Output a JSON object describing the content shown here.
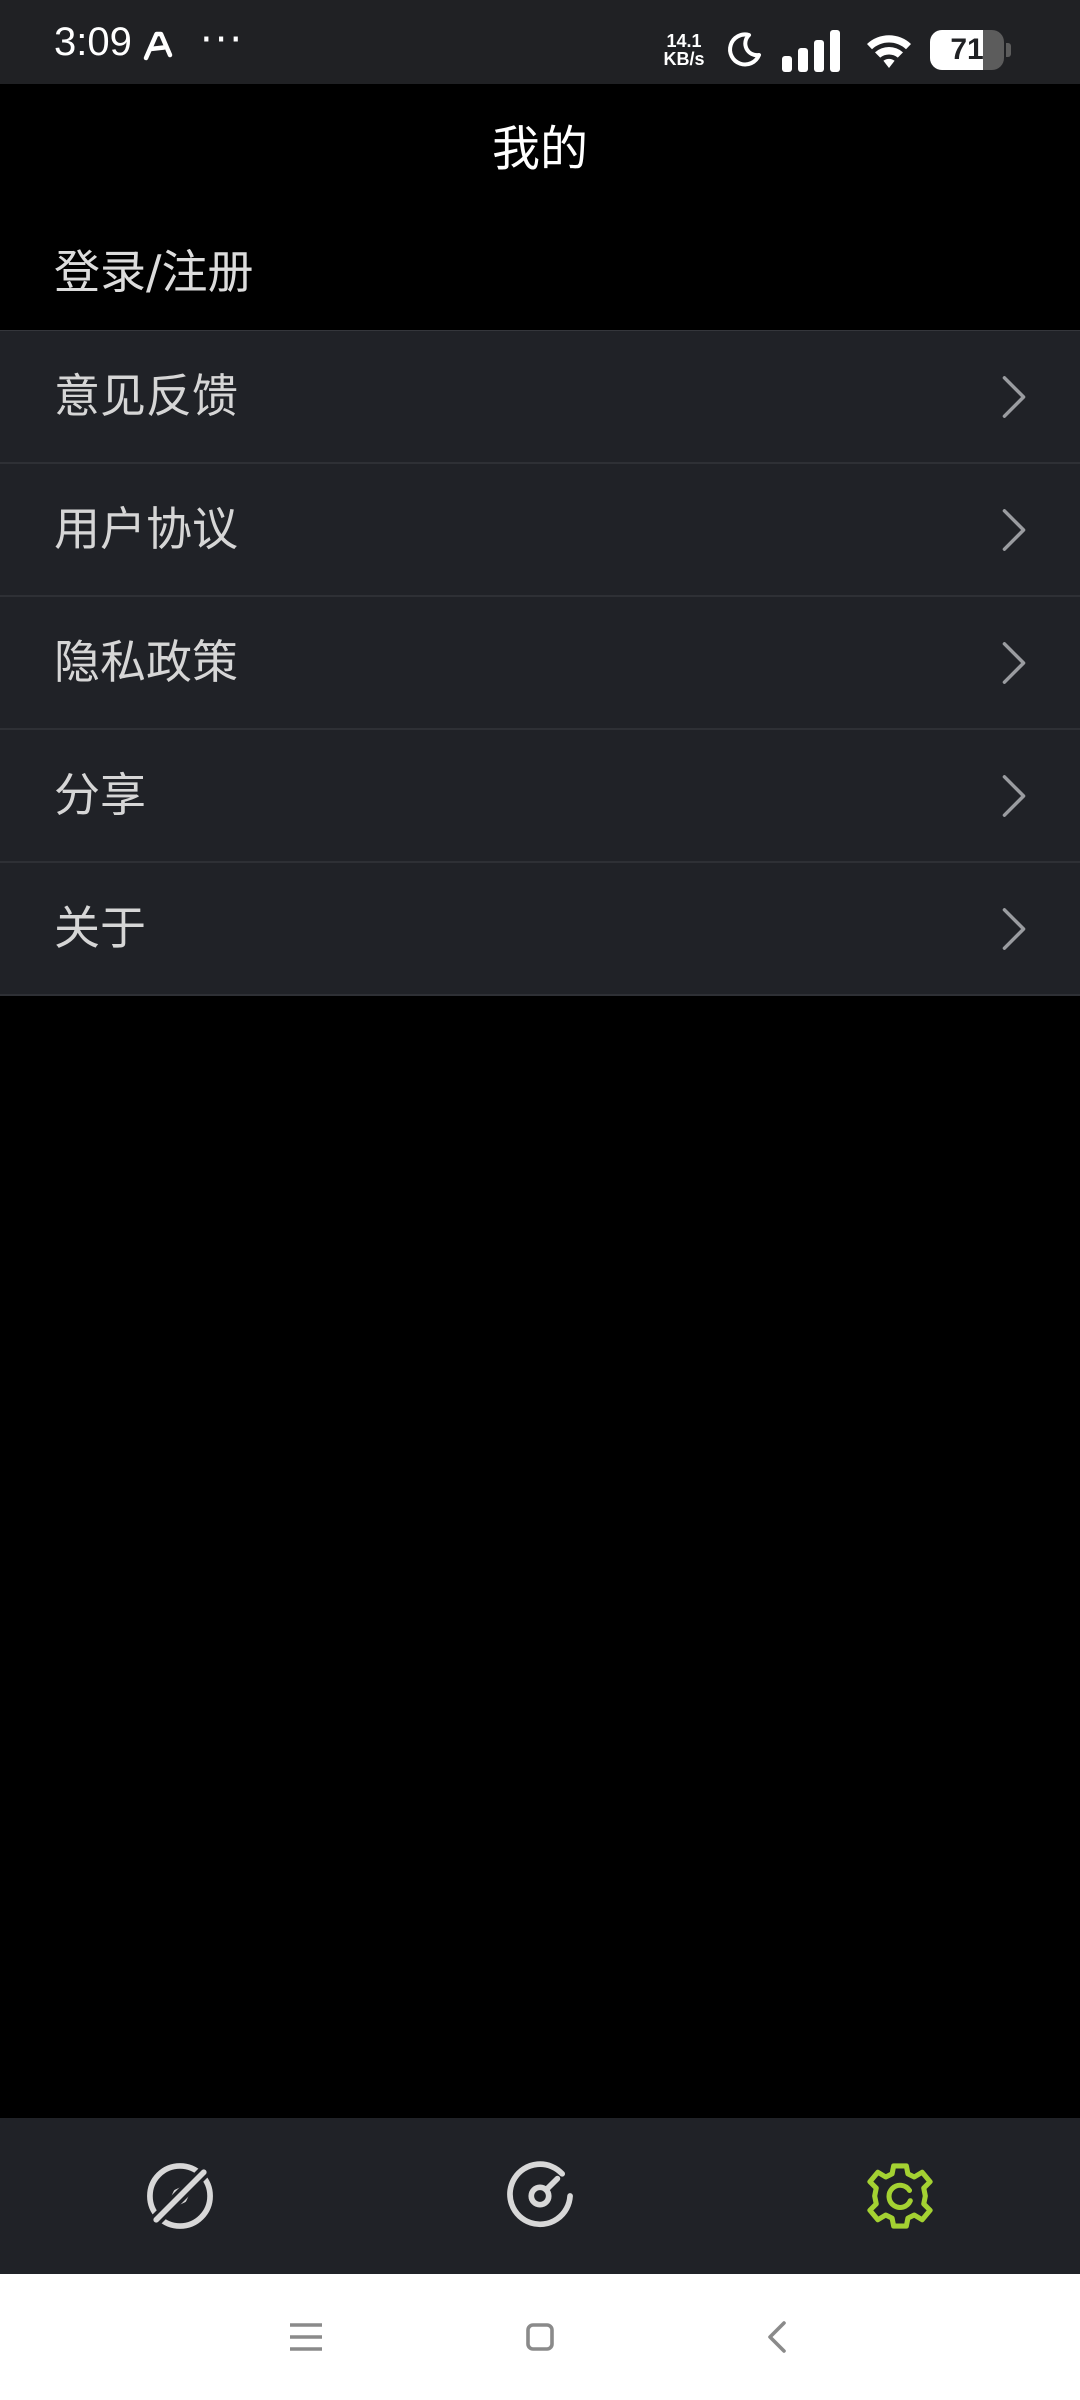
{
  "status_bar": {
    "time": "3:09",
    "more": "···",
    "net_speed_value": "14.1",
    "net_speed_unit": "KB/s",
    "battery_level": "71",
    "battery_fraction": 0.71,
    "icons": [
      "app-notification-icon",
      "moon-icon",
      "signal-icon",
      "wifi-icon",
      "battery-icon"
    ]
  },
  "header": {
    "title": "我的"
  },
  "account": {
    "login_label": "登录/注册"
  },
  "menu": {
    "items": [
      {
        "label": "意见反馈",
        "icon": "chevron-right-icon"
      },
      {
        "label": "用户协议",
        "icon": "chevron-right-icon"
      },
      {
        "label": "隐私政策",
        "icon": "chevron-right-icon"
      },
      {
        "label": "分享",
        "icon": "chevron-right-icon"
      },
      {
        "label": "关于",
        "icon": "chevron-right-icon"
      }
    ]
  },
  "tab_bar": {
    "tabs": [
      {
        "icon": "compass-off-icon",
        "active": false
      },
      {
        "icon": "speedometer-icon",
        "active": false
      },
      {
        "icon": "gear-icon",
        "active": true
      }
    ],
    "active_color": "#a4d232",
    "inactive_color": "#d8d8d8"
  },
  "nav_bar": {
    "icons": [
      "menu-icon",
      "home-icon",
      "back-icon"
    ]
  },
  "colors": {
    "background": "#000000",
    "surface": "#202227",
    "accent": "#a4d232"
  }
}
